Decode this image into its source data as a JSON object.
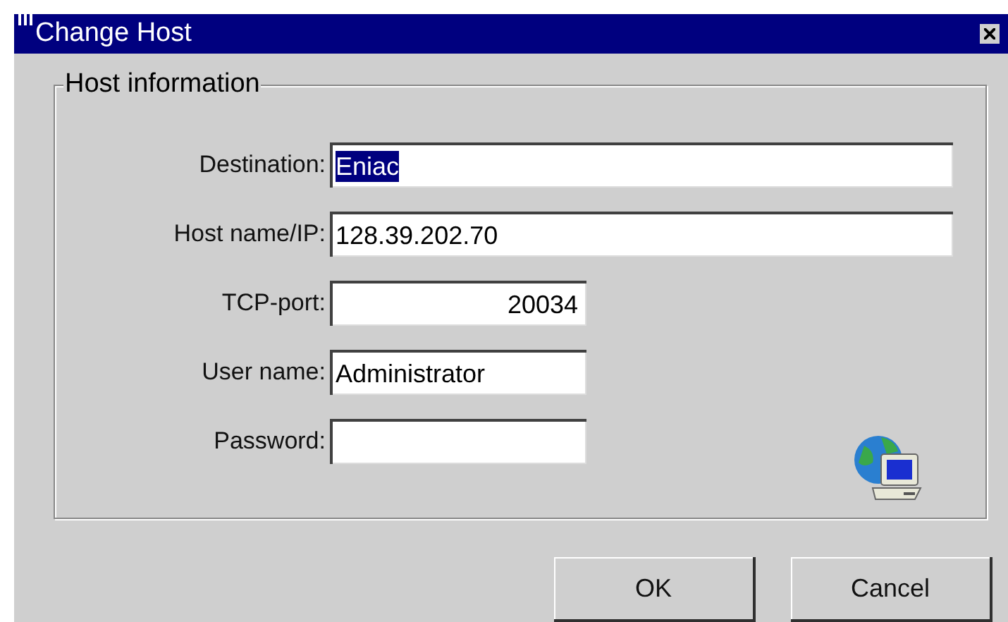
{
  "window": {
    "title": "Change Host"
  },
  "group": {
    "title": "Host information"
  },
  "fields": [
    {
      "label": "Destination:",
      "value": "Eniac",
      "kind": "wide",
      "selected": true
    },
    {
      "label": "Host name/IP:",
      "value": "128.39.202.70",
      "kind": "wide",
      "selected": false
    },
    {
      "label": "TCP-port:",
      "value": "20034",
      "kind": "numeric",
      "selected": false
    },
    {
      "label": "User name:",
      "value": "Administrator",
      "kind": "short",
      "selected": false
    },
    {
      "label": "Password:",
      "kind": "short",
      "selected": false
    }
  ],
  "buttons": [
    "OK",
    "Cancel"
  ]
}
